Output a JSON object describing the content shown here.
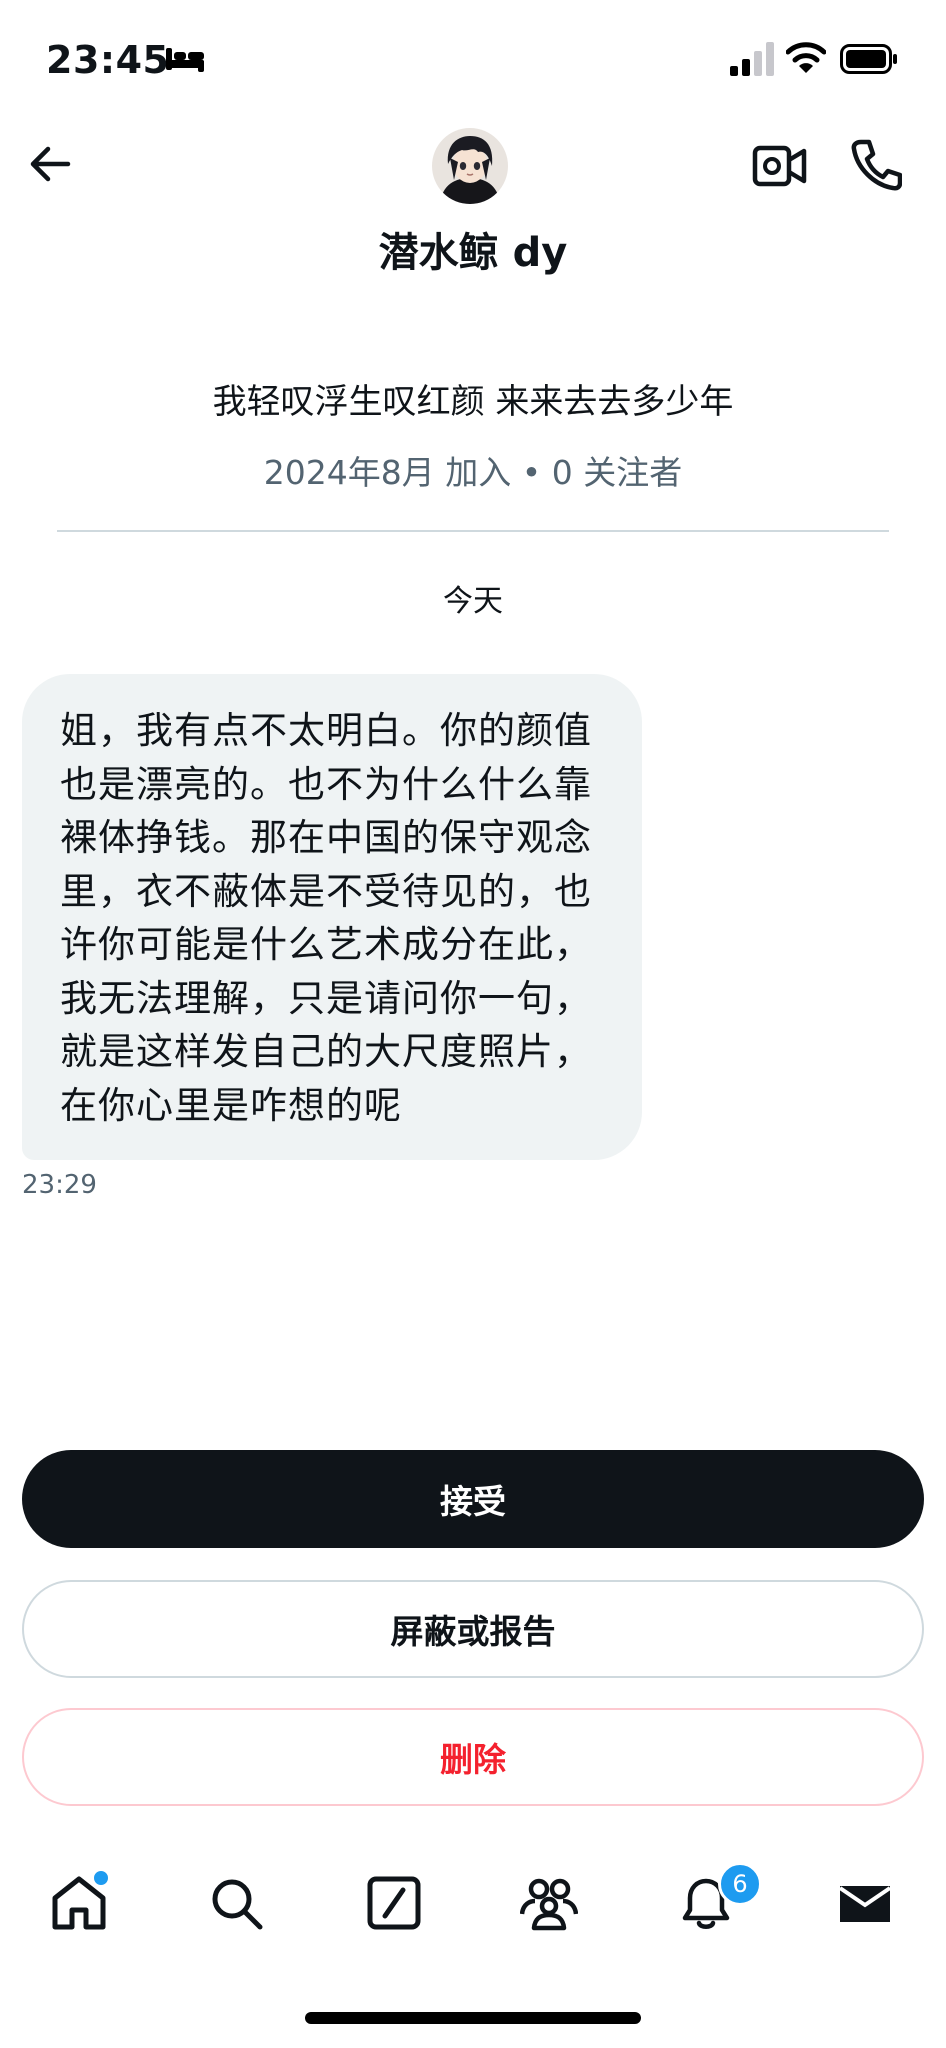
{
  "status_bar": {
    "time": "23:45",
    "sleep_icon": "bed-icon",
    "signal_icon": "cellular-signal-icon",
    "wifi_icon": "wifi-icon",
    "battery_icon": "battery-icon"
  },
  "header": {
    "back_icon": "arrow-left-icon",
    "avatar": "anime-avatar",
    "video_icon": "video-camera-icon",
    "call_icon": "phone-icon"
  },
  "profile": {
    "name": "潜水鲸 dy",
    "bio": "我轻叹浮生叹红颜  来来去去多少年",
    "meta": "2024年8月 加入 • 0 关注者"
  },
  "conversation": {
    "date_separator": "今天",
    "message": {
      "lines": [
        "姐，我有点不太明白。你的颜值",
        "也是漂亮的。也不为什么什么靠",
        "裸体挣钱。那在中国的保守观念",
        "里，衣不蔽体是不受待见的，也",
        "许你可能是什么艺术成分在此，",
        "我无法理解，只是请问你一句，",
        "就是这样发自己的大尺度照片，",
        "在你心里是咋想的呢"
      ],
      "time": "23:29"
    }
  },
  "actions": {
    "accept": "接受",
    "block_or_report": "屏蔽或报告",
    "delete": "删除"
  },
  "colors": {
    "primary_dark": "#0f1419",
    "secondary_text": "#536471",
    "bubble_bg": "#eff3f4",
    "danger": "#f4212e",
    "accent_blue": "#1d9bf0"
  },
  "bottom_nav": {
    "items": [
      "home-icon",
      "search-icon",
      "grok-icon",
      "communities-icon",
      "notifications-icon",
      "messages-icon"
    ],
    "notification_count": "6"
  }
}
